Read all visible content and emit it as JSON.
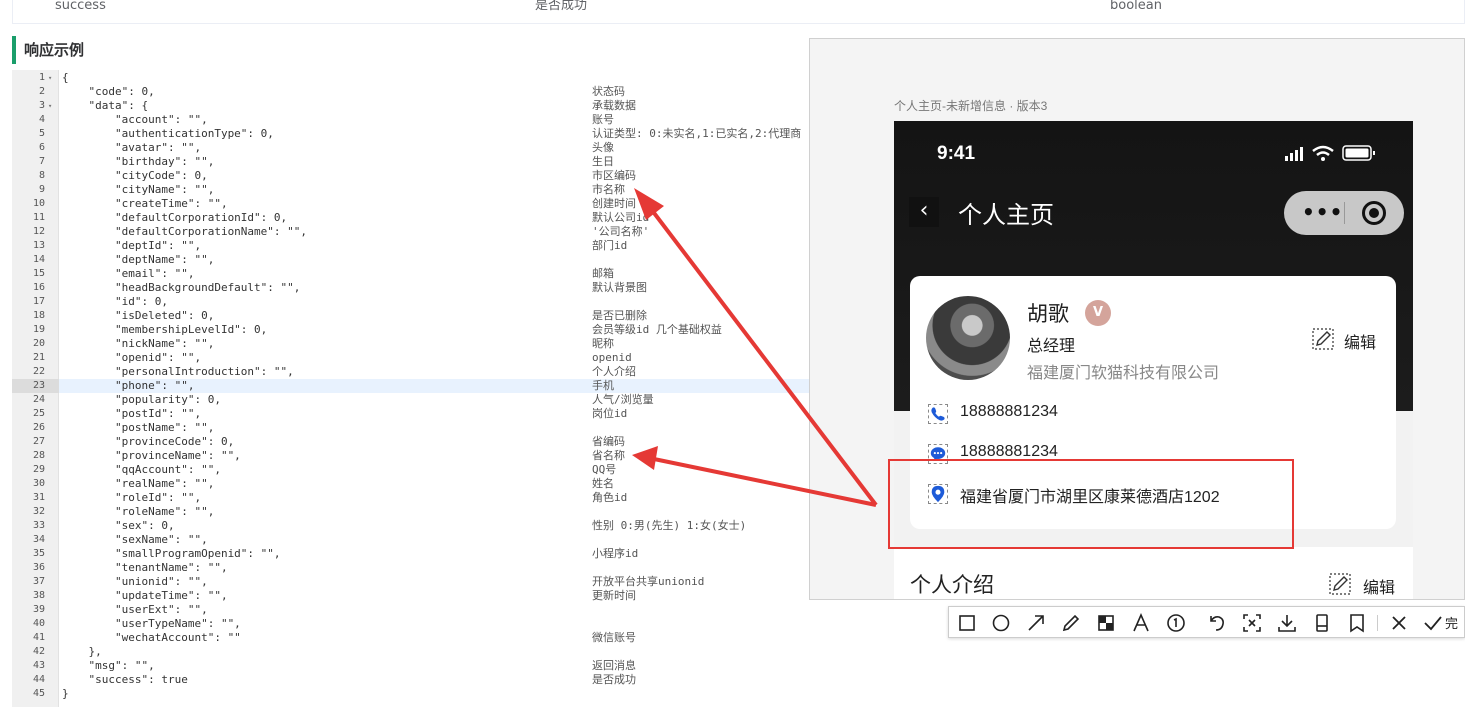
{
  "table_row": {
    "name": "success",
    "desc": "是否成功",
    "type": "boolean"
  },
  "section_title": "响应示例",
  "editor": {
    "lines": [
      {
        "n": "1",
        "fold": "▾",
        "code": "{",
        "cmt": ""
      },
      {
        "n": "2",
        "fold": "",
        "code": "    \"code\": 0,",
        "cmt": "状态码"
      },
      {
        "n": "3",
        "fold": "▾",
        "code": "    \"data\": {",
        "cmt": "承载数据"
      },
      {
        "n": "4",
        "fold": "",
        "code": "        \"account\": \"\",",
        "cmt": "账号"
      },
      {
        "n": "5",
        "fold": "",
        "code": "        \"authenticationType\": 0,",
        "cmt": "认证类型: 0:未实名,1:已实名,2:代理商"
      },
      {
        "n": "6",
        "fold": "",
        "code": "        \"avatar\": \"\",",
        "cmt": "头像"
      },
      {
        "n": "7",
        "fold": "",
        "code": "        \"birthday\": \"\",",
        "cmt": "生日"
      },
      {
        "n": "8",
        "fold": "",
        "code": "        \"cityCode\": 0,",
        "cmt": "市区编码"
      },
      {
        "n": "9",
        "fold": "",
        "code": "        \"cityName\": \"\",",
        "cmt": "市名称"
      },
      {
        "n": "10",
        "fold": "",
        "code": "        \"createTime\": \"\",",
        "cmt": "创建时间"
      },
      {
        "n": "11",
        "fold": "",
        "code": "        \"defaultCorporationId\": 0,",
        "cmt": "默认公司id"
      },
      {
        "n": "12",
        "fold": "",
        "code": "        \"defaultCorporationName\": \"\",",
        "cmt": "'公司名称'"
      },
      {
        "n": "13",
        "fold": "",
        "code": "        \"deptId\": \"\",",
        "cmt": "部门id"
      },
      {
        "n": "14",
        "fold": "",
        "code": "        \"deptName\": \"\",",
        "cmt": ""
      },
      {
        "n": "15",
        "fold": "",
        "code": "        \"email\": \"\",",
        "cmt": "邮箱"
      },
      {
        "n": "16",
        "fold": "",
        "code": "        \"headBackgroundDefault\": \"\",",
        "cmt": "默认背景图"
      },
      {
        "n": "17",
        "fold": "",
        "code": "        \"id\": 0,",
        "cmt": ""
      },
      {
        "n": "18",
        "fold": "",
        "code": "        \"isDeleted\": 0,",
        "cmt": "是否已删除"
      },
      {
        "n": "19",
        "fold": "",
        "code": "        \"membershipLevelId\": 0,",
        "cmt": "会员等级id 几个基础权益"
      },
      {
        "n": "20",
        "fold": "",
        "code": "        \"nickName\": \"\",",
        "cmt": "昵称"
      },
      {
        "n": "21",
        "fold": "",
        "code": "        \"openid\": \"\",",
        "cmt": "openid"
      },
      {
        "n": "22",
        "fold": "",
        "code": "        \"personalIntroduction\": \"\",",
        "cmt": "个人介绍"
      },
      {
        "n": "23",
        "fold": "",
        "code": "        \"phone\": \"\",",
        "cmt": "手机"
      },
      {
        "n": "24",
        "fold": "",
        "code": "        \"popularity\": 0,",
        "cmt": "人气/浏览量"
      },
      {
        "n": "25",
        "fold": "",
        "code": "        \"postId\": \"\",",
        "cmt": "岗位id"
      },
      {
        "n": "26",
        "fold": "",
        "code": "        \"postName\": \"\",",
        "cmt": ""
      },
      {
        "n": "27",
        "fold": "",
        "code": "        \"provinceCode\": 0,",
        "cmt": "省编码"
      },
      {
        "n": "28",
        "fold": "",
        "code": "        \"provinceName\": \"\",",
        "cmt": "省名称"
      },
      {
        "n": "29",
        "fold": "",
        "code": "        \"qqAccount\": \"\",",
        "cmt": "QQ号"
      },
      {
        "n": "30",
        "fold": "",
        "code": "        \"realName\": \"\",",
        "cmt": "姓名"
      },
      {
        "n": "31",
        "fold": "",
        "code": "        \"roleId\": \"\",",
        "cmt": "角色id"
      },
      {
        "n": "32",
        "fold": "",
        "code": "        \"roleName\": \"\",",
        "cmt": ""
      },
      {
        "n": "33",
        "fold": "",
        "code": "        \"sex\": 0,",
        "cmt": "性别 0:男(先生) 1:女(女士)"
      },
      {
        "n": "34",
        "fold": "",
        "code": "        \"sexName\": \"\",",
        "cmt": ""
      },
      {
        "n": "35",
        "fold": "",
        "code": "        \"smallProgramOpenid\": \"\",",
        "cmt": "小程序id"
      },
      {
        "n": "36",
        "fold": "",
        "code": "        \"tenantName\": \"\",",
        "cmt": ""
      },
      {
        "n": "37",
        "fold": "",
        "code": "        \"unionid\": \"\",",
        "cmt": "开放平台共享unionid"
      },
      {
        "n": "38",
        "fold": "",
        "code": "        \"updateTime\": \"\",",
        "cmt": "更新时间"
      },
      {
        "n": "39",
        "fold": "",
        "code": "        \"userExt\": \"\",",
        "cmt": ""
      },
      {
        "n": "40",
        "fold": "",
        "code": "        \"userTypeName\": \"\",",
        "cmt": ""
      },
      {
        "n": "41",
        "fold": "",
        "code": "        \"wechatAccount\": \"\"",
        "cmt": "微信账号"
      },
      {
        "n": "42",
        "fold": "",
        "code": "    },",
        "cmt": ""
      },
      {
        "n": "43",
        "fold": "",
        "code": "    \"msg\": \"\",",
        "cmt": "返回消息"
      },
      {
        "n": "44",
        "fold": "",
        "code": "    \"success\": true",
        "cmt": "是否成功"
      },
      {
        "n": "45",
        "fold": "",
        "code": "}",
        "cmt": ""
      }
    ],
    "highlighted_line": 23
  },
  "preview": {
    "caption": "个人主页-未新增信息 · 版本3",
    "phone": {
      "time": "9:41",
      "nav_title": "个人主页",
      "back_glyph": "‹",
      "capsule_dots": "•••",
      "profile": {
        "name": "胡歌",
        "badge": "V",
        "job_title": "总经理",
        "company": "福建厦门软猫科技有限公司",
        "edit_label": "编辑"
      },
      "info": {
        "phone": "18888881234",
        "wechat": "18888881234",
        "address": "福建省厦门市湖里区康莱德酒店1202"
      },
      "intro_title": "个人介绍",
      "intro_edit_label": "编辑"
    }
  },
  "toolbar": {
    "tools": [
      "rectangle-icon",
      "circle-icon",
      "arrow-icon",
      "pen-icon",
      "mosaic-icon",
      "text-icon",
      "number-icon",
      "undo-icon",
      "pin-icon",
      "download-icon",
      "long-screenshot-icon",
      "bookmark-icon",
      "close-icon",
      "confirm-icon"
    ],
    "done_label": "完"
  },
  "colors": {
    "section_accent": "#1a9e6b",
    "annotation_red": "#e53935",
    "icon_blue": "#1e5bd8",
    "line_highlight": "#e8f2fe"
  }
}
